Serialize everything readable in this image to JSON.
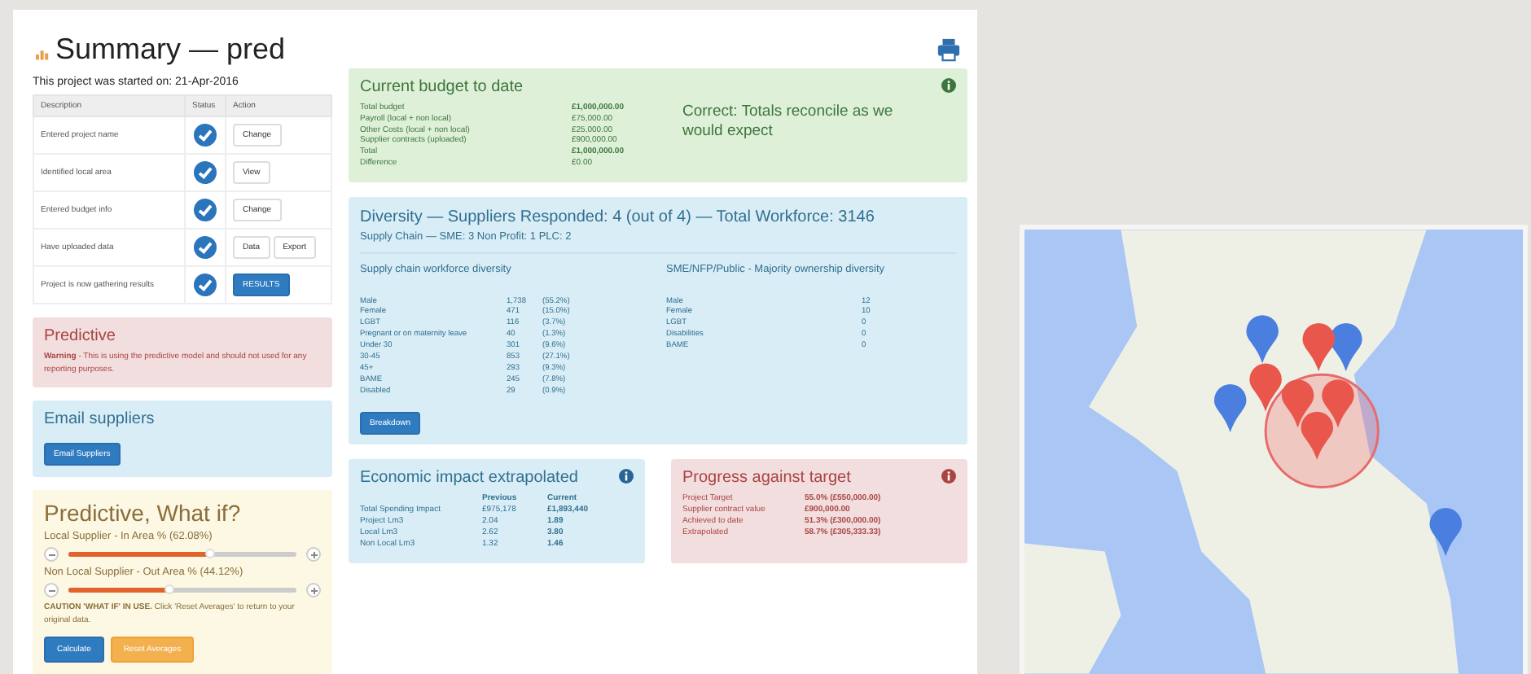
{
  "header": {
    "title": "Summary — pred"
  },
  "started": "This project was started on: 21-Apr-2016",
  "steps": {
    "columns": [
      "Description",
      "Status",
      "Action"
    ],
    "rows": [
      {
        "description": "Entered project name",
        "done": true,
        "actions": [
          {
            "label": "Change",
            "kind": "default"
          }
        ]
      },
      {
        "description": "Identified local area",
        "done": true,
        "actions": [
          {
            "label": "View",
            "kind": "default"
          }
        ]
      },
      {
        "description": "Entered budget info",
        "done": true,
        "actions": [
          {
            "label": "Change",
            "kind": "default"
          }
        ]
      },
      {
        "description": "Have uploaded data",
        "done": true,
        "actions": [
          {
            "label": "Data",
            "kind": "default"
          },
          {
            "label": "Export",
            "kind": "default"
          }
        ]
      },
      {
        "description": "Project is now gathering results",
        "done": true,
        "actions": [
          {
            "label": "RESULTS",
            "kind": "primary"
          }
        ]
      }
    ]
  },
  "predictive": {
    "title": "Predictive",
    "warning": "**Warning** - This is using the predictive model and should not used for any reporting purposes."
  },
  "email": {
    "title": "Email suppliers",
    "button": "Email Suppliers"
  },
  "what_if": {
    "title": "Predictive, What if?",
    "sliders": [
      {
        "label": "Local Supplier - In Area % (62.08%)",
        "level": 0.62
      },
      {
        "label": "Non Local Supplier - Out Area % (44.12%)",
        "level": 0.44
      }
    ],
    "caution": "**CAUTION 'WHAT IF' IN USE.** Click 'Reset Averages' to return to your original data.",
    "buttons": [
      {
        "label": "Calculate",
        "kind": "primary"
      },
      {
        "label": "Reset Averages",
        "kind": "warning"
      }
    ]
  },
  "budget": {
    "title": "Current budget to date",
    "rows": [
      {
        "label": "Total budget",
        "value": "£1,000,000.00",
        "bold": true
      },
      {
        "label": "Payroll (local + non local)",
        "value": "£75,000.00",
        "bold": false
      },
      {
        "label": "Other Costs (local + non local)",
        "value": "£25,000.00",
        "bold": false
      },
      {
        "label": "Supplier contracts (uploaded)",
        "value": "£900,000.00",
        "bold": false
      },
      {
        "label": "Total",
        "value": "£1,000,000.00",
        "bold": true
      },
      {
        "label": "Difference",
        "value": "£0.00",
        "bold": false
      }
    ],
    "message": "Correct: Totals reconcile as we would expect"
  },
  "diversity": {
    "title": "Diversity — Suppliers Responded: 4 (out of 4) — Total Workforce: 3146",
    "subtitle": "Supply Chain — SME: 3   Non Profit: 1   PLC: 2",
    "workforce": {
      "title": "Supply chain workforce diversity",
      "rows": [
        {
          "label": "Male",
          "count": "1,738",
          "share": "(55.2%)"
        },
        {
          "label": "Female",
          "count": "471",
          "share": "(15.0%)"
        },
        {
          "label": "LGBT",
          "count": "116",
          "share": "(3.7%)"
        },
        {
          "label": "Pregnant or on maternity leave",
          "count": "40",
          "share": "(1.3%)"
        },
        {
          "label": "Under 30",
          "count": "301",
          "share": "(9.6%)"
        },
        {
          "label": "30-45",
          "count": "853",
          "share": "(27.1%)"
        },
        {
          "label": "45+",
          "count": "293",
          "share": "(9.3%)"
        },
        {
          "label": "BAME",
          "count": "245",
          "share": "(7.8%)"
        },
        {
          "label": "Disabled",
          "count": "29",
          "share": "(0.9%)"
        }
      ]
    },
    "ownership": {
      "title": "SME/NFP/Public - Majority ownership diversity",
      "rows": [
        {
          "label": "Male",
          "count": "12"
        },
        {
          "label": "Female",
          "count": "10"
        },
        {
          "label": "LGBT",
          "count": "0"
        },
        {
          "label": "Disabilities",
          "count": "0"
        },
        {
          "label": "BAME",
          "count": "0"
        }
      ]
    },
    "button": "Breakdown"
  },
  "economic": {
    "title": "Economic impact extrapolated",
    "columns": [
      "Previous",
      "Current"
    ],
    "rows": [
      {
        "label": "Total Spending Impact",
        "previous": "£975,178",
        "current": "£1,893,440"
      },
      {
        "label": "Project Lm3",
        "previous": "2.04",
        "current": "1.89"
      },
      {
        "label": "Local Lm3",
        "previous": "2.62",
        "current": "3.80"
      },
      {
        "label": "Non Local Lm3",
        "previous": "1.32",
        "current": "1.46"
      }
    ]
  },
  "progress": {
    "title": "Progress against target",
    "rows": [
      {
        "label": "Project Target",
        "value": "55.0% (£550,000.00)"
      },
      {
        "label": "Supplier contract value",
        "value": "£900,000.00"
      },
      {
        "label": "Achieved to date",
        "value": "51.3% (£300,000.00)"
      },
      {
        "label": "Extrapolated",
        "value": "58.7% (£305,333.33)"
      }
    ]
  }
}
